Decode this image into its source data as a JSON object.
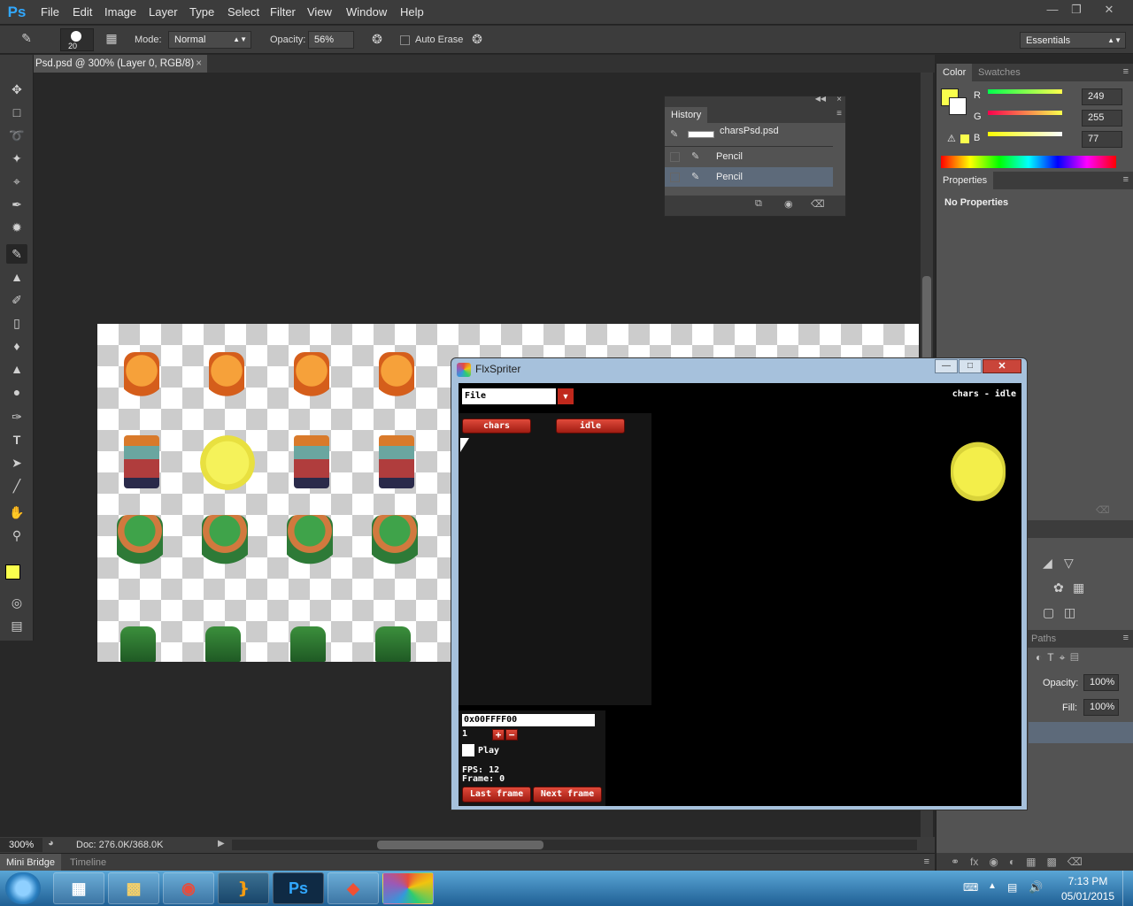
{
  "menubar": {
    "logo": "Ps",
    "items": [
      "File",
      "Edit",
      "Image",
      "Layer",
      "Type",
      "Select",
      "Filter",
      "View",
      "Window",
      "Help"
    ]
  },
  "options": {
    "brush_size": "20",
    "mode_label": "Mode:",
    "mode_value": "Normal",
    "opacity_label": "Opacity:",
    "opacity_value": "56%",
    "auto_erase": "Auto Erase",
    "workspace": "Essentials"
  },
  "document": {
    "tab_title": "Psd.psd @ 300% (Layer 0, RGB/8)",
    "zoom": "300%",
    "doc_info": "Doc: 276.0K/368.0K"
  },
  "history": {
    "title": "History",
    "snapshot": "charsPsd.psd",
    "steps": [
      "Pencil",
      "Pencil"
    ]
  },
  "color_panel": {
    "tabs": [
      "Color",
      "Swatches"
    ],
    "channels": [
      {
        "label": "R",
        "value": "249"
      },
      {
        "label": "G",
        "value": "255"
      },
      {
        "label": "B",
        "value": "77"
      }
    ],
    "foreground": "#f9ff4d"
  },
  "properties": {
    "tab": "Properties",
    "text": "No Properties"
  },
  "layers_panel": {
    "paths_tab": "Paths",
    "opacity_label": "Opacity:",
    "opacity_value": "100%",
    "fill_label": "Fill:",
    "fill_value": "100%"
  },
  "bottom_tabs": [
    "Mini Bridge",
    "Timeline"
  ],
  "flxspriter": {
    "title": "FlxSpriter",
    "file_label": "File",
    "header_right": "chars - idle",
    "buttons": [
      "chars",
      "idle"
    ],
    "color_value": "0x00FFFF00",
    "step_value": "1",
    "play_label": "Play",
    "fps": "FPS: 12",
    "frame": "Frame: 0",
    "last_frame": "Last frame",
    "next_frame": "Next frame"
  },
  "taskbar": {
    "time": "7:13 PM",
    "date": "05/01/2015",
    "apps": [
      "start",
      "metro",
      "explorer",
      "chrome",
      "flashdevelop",
      "photoshop",
      "git",
      "flxspriter"
    ]
  }
}
